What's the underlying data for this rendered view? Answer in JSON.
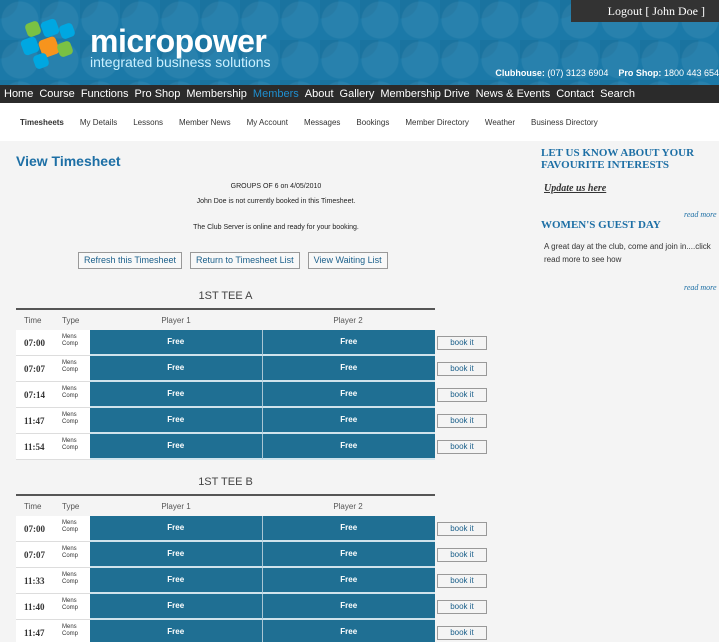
{
  "header": {
    "brand": "micropower",
    "tagline": "integrated business solutions",
    "logout": "Logout [ John Doe ]",
    "clubhouse_label": "Clubhouse:",
    "clubhouse_phone": "(07) 3123 6904",
    "proshop_label": "Pro Shop:",
    "proshop_phone": "1800 443 654"
  },
  "mainnav": [
    "Home",
    "Course",
    "Functions",
    "Pro Shop",
    "Membership",
    "Members",
    "About",
    "Gallery",
    "Membership Drive",
    "News & Events",
    "Contact",
    "Search"
  ],
  "mainnav_active": "Members",
  "subnav": [
    "Timesheets",
    "My Details",
    "Lessons",
    "Member News",
    "My Account",
    "Messages",
    "Bookings",
    "Member Directory",
    "Weather",
    "Business Directory"
  ],
  "subnav_active": "Timesheets",
  "page_title": "View Timesheet",
  "info": {
    "groups": "GROUPS OF 6 on 4/05/2010",
    "booking_status": "John Doe is not currently booked in this Timesheet.",
    "server_status": "The Club Server is online and ready for your booking."
  },
  "buttons": {
    "refresh": "Refresh this Timesheet",
    "return": "Return to Timesheet List",
    "waiting": "View Waiting List"
  },
  "columns": {
    "time": "Time",
    "type": "Type",
    "player1": "Player 1",
    "player2": "Player 2"
  },
  "tees": [
    {
      "title": "1ST TEE A",
      "rows": [
        {
          "time": "07:00",
          "type_line1": "Mens",
          "type_line2": "Comp",
          "p1": "Free",
          "p2": "Free",
          "book": "book it"
        },
        {
          "time": "07:07",
          "type_line1": "Mens",
          "type_line2": "Comp",
          "p1": "Free",
          "p2": "Free",
          "book": "book it"
        },
        {
          "time": "07:14",
          "type_line1": "Mens",
          "type_line2": "Comp",
          "p1": "Free",
          "p2": "Free",
          "book": "book it"
        },
        {
          "time": "11:47",
          "type_line1": "Mens",
          "type_line2": "Comp",
          "p1": "Free",
          "p2": "Free",
          "book": "book it"
        },
        {
          "time": "11:54",
          "type_line1": "Mens",
          "type_line2": "Comp",
          "p1": "Free",
          "p2": "Free",
          "book": "book it"
        }
      ]
    },
    {
      "title": "1ST TEE B",
      "rows": [
        {
          "time": "07:00",
          "type_line1": "Mens",
          "type_line2": "Comp",
          "p1": "Free",
          "p2": "Free",
          "book": "book it"
        },
        {
          "time": "07:07",
          "type_line1": "Mens",
          "type_line2": "Comp",
          "p1": "Free",
          "p2": "Free",
          "book": "book it"
        },
        {
          "time": "11:33",
          "type_line1": "Mens",
          "type_line2": "Comp",
          "p1": "Free",
          "p2": "Free",
          "book": "book it"
        },
        {
          "time": "11:40",
          "type_line1": "Mens",
          "type_line2": "Comp",
          "p1": "Free",
          "p2": "Free",
          "book": "book it"
        },
        {
          "time": "11:47",
          "type_line1": "Mens",
          "type_line2": "Comp",
          "p1": "Free",
          "p2": "Free",
          "book": "book it"
        }
      ]
    }
  ],
  "sidebar": {
    "interests_heading": "LET US KNOW ABOUT YOUR FAVOURITE INTERESTS",
    "update_link": "Update us here",
    "read_more": "read more",
    "guest_heading": "WOMEN'S GUEST DAY",
    "guest_text": "A great day at the club, come and join in....click read more to see how"
  },
  "colors": {
    "accent": "#1d6fa5",
    "header_bg": "#1b79a8",
    "nav_bg": "#2b2b2b",
    "cell_bg": "#1f6f93"
  }
}
